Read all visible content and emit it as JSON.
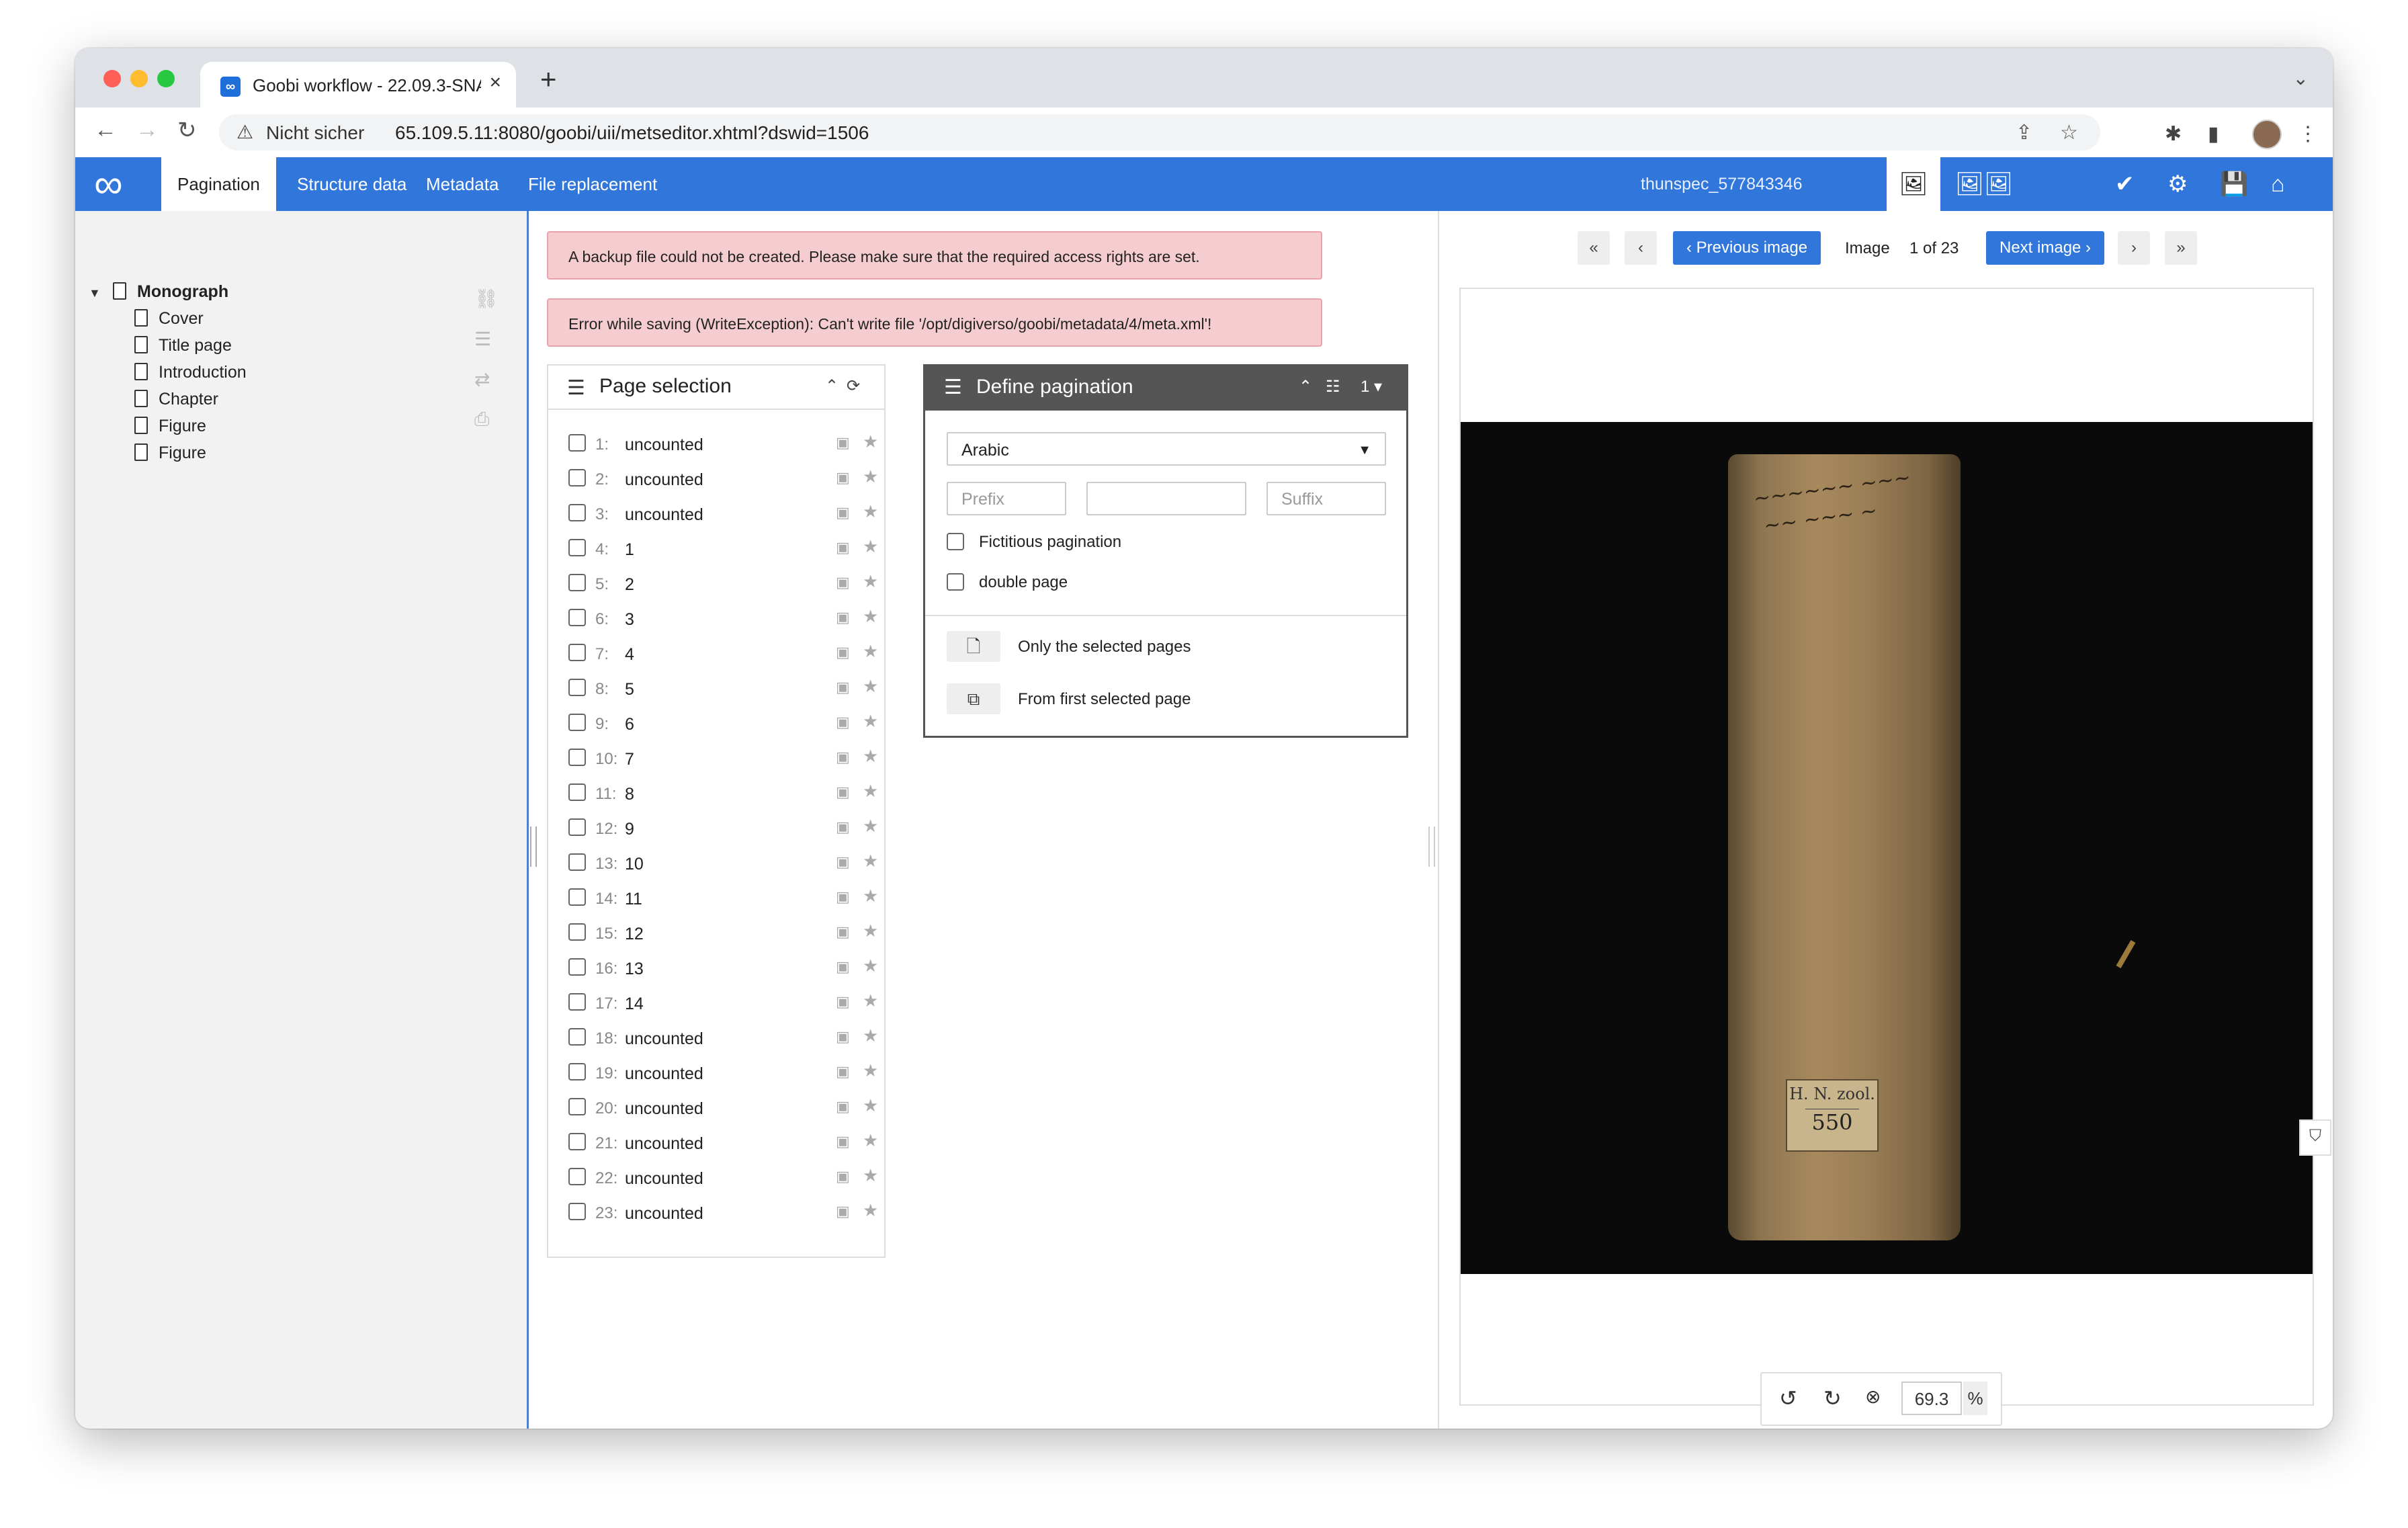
{
  "browser": {
    "tab_title": "Goobi workflow - 22.09.3-SNA",
    "tab_favicon": "∞",
    "security_label": "Nicht sicher",
    "url": "65.109.5.11:8080/goobi/uii/metseditor.xhtml?dswid=1506"
  },
  "app": {
    "tabs": [
      "Pagination",
      "Structure data",
      "Metadata",
      "File replacement"
    ],
    "record_id": "thunspec_577843346",
    "brand_color": "#3176db"
  },
  "tree": {
    "root": "Monograph",
    "children": [
      "Cover",
      "Title page",
      "Introduction",
      "Chapter",
      "Figure",
      "Figure"
    ]
  },
  "alerts": [
    "A backup file could not be created. Please make sure that the required access rights are set.",
    "Error while saving (WriteException): Can't write file '/opt/digiverso/goobi/metadata/4/meta.xml'!"
  ],
  "page_selection": {
    "title": "Page selection",
    "pages": [
      {
        "num": "1:",
        "label": "uncounted"
      },
      {
        "num": "2:",
        "label": "uncounted"
      },
      {
        "num": "3:",
        "label": "uncounted"
      },
      {
        "num": "4:",
        "label": "1"
      },
      {
        "num": "5:",
        "label": "2"
      },
      {
        "num": "6:",
        "label": "3"
      },
      {
        "num": "7:",
        "label": "4"
      },
      {
        "num": "8:",
        "label": "5"
      },
      {
        "num": "9:",
        "label": "6"
      },
      {
        "num": "10:",
        "label": "7"
      },
      {
        "num": "11:",
        "label": "8"
      },
      {
        "num": "12:",
        "label": "9"
      },
      {
        "num": "13:",
        "label": "10"
      },
      {
        "num": "14:",
        "label": "11"
      },
      {
        "num": "15:",
        "label": "12"
      },
      {
        "num": "16:",
        "label": "13"
      },
      {
        "num": "17:",
        "label": "14"
      },
      {
        "num": "18:",
        "label": "uncounted"
      },
      {
        "num": "19:",
        "label": "uncounted"
      },
      {
        "num": "20:",
        "label": "uncounted"
      },
      {
        "num": "21:",
        "label": "uncounted"
      },
      {
        "num": "22:",
        "label": "uncounted"
      },
      {
        "num": "23:",
        "label": "uncounted"
      }
    ]
  },
  "define_pagination": {
    "title": "Define pagination",
    "count": "1",
    "type_value": "Arabic",
    "prefix_placeholder": "Prefix",
    "start_value": "",
    "suffix_placeholder": "Suffix",
    "fictitious_label": "Fictitious pagination",
    "double_page_label": "double page",
    "only_selected_label": "Only the selected pages",
    "from_first_label": "From first selected page"
  },
  "image_viewer": {
    "prev_label": "Previous image",
    "next_label": "Next image",
    "image_word": "Image",
    "counter": "1 of 23",
    "zoom_value": "69.3",
    "zoom_unit": "%",
    "spine_label_line1": "H. N. zool.",
    "spine_label_line2": "550"
  }
}
